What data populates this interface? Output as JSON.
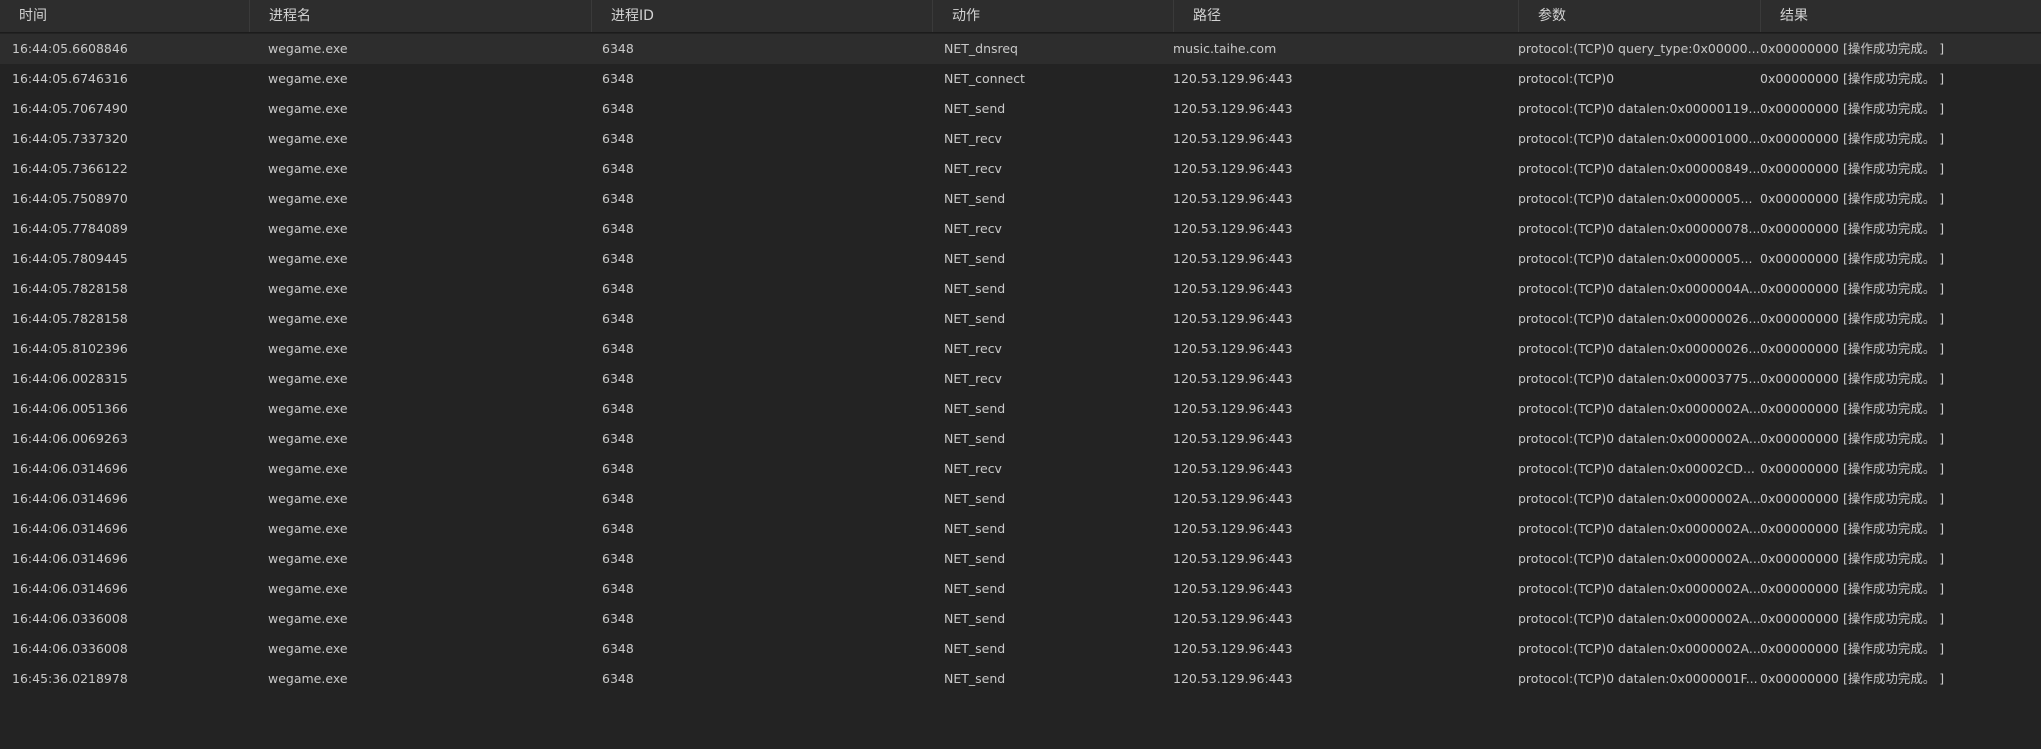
{
  "columns": [
    "时间",
    "进程名",
    "进程ID",
    "动作",
    "路径",
    "参数",
    "结果"
  ],
  "rows": [
    [
      "16:44:05.6608846",
      "wegame.exe",
      "6348",
      "NET_dnsreq",
      "music.taihe.com",
      "protocol:(TCP)0 query_type:0x00000...",
      "0x00000000 [操作成功完成。 ]"
    ],
    [
      "16:44:05.6746316",
      "wegame.exe",
      "6348",
      "NET_connect",
      "120.53.129.96:443",
      "protocol:(TCP)0",
      "0x00000000 [操作成功完成。 ]"
    ],
    [
      "16:44:05.7067490",
      "wegame.exe",
      "6348",
      "NET_send",
      "120.53.129.96:443",
      "protocol:(TCP)0 datalen:0x00000119...",
      "0x00000000 [操作成功完成。 ]"
    ],
    [
      "16:44:05.7337320",
      "wegame.exe",
      "6348",
      "NET_recv",
      "120.53.129.96:443",
      "protocol:(TCP)0 datalen:0x00001000...",
      "0x00000000 [操作成功完成。 ]"
    ],
    [
      "16:44:05.7366122",
      "wegame.exe",
      "6348",
      "NET_recv",
      "120.53.129.96:443",
      "protocol:(TCP)0 datalen:0x00000849...",
      "0x00000000 [操作成功完成。 ]"
    ],
    [
      "16:44:05.7508970",
      "wegame.exe",
      "6348",
      "NET_send",
      "120.53.129.96:443",
      "protocol:(TCP)0 datalen:0x0000005...",
      "0x00000000 [操作成功完成。 ]"
    ],
    [
      "16:44:05.7784089",
      "wegame.exe",
      "6348",
      "NET_recv",
      "120.53.129.96:443",
      "protocol:(TCP)0 datalen:0x00000078...",
      "0x00000000 [操作成功完成。 ]"
    ],
    [
      "16:44:05.7809445",
      "wegame.exe",
      "6348",
      "NET_send",
      "120.53.129.96:443",
      "protocol:(TCP)0 datalen:0x0000005...",
      "0x00000000 [操作成功完成。 ]"
    ],
    [
      "16:44:05.7828158",
      "wegame.exe",
      "6348",
      "NET_send",
      "120.53.129.96:443",
      "protocol:(TCP)0 datalen:0x0000004A...",
      "0x00000000 [操作成功完成。 ]"
    ],
    [
      "16:44:05.7828158",
      "wegame.exe",
      "6348",
      "NET_send",
      "120.53.129.96:443",
      "protocol:(TCP)0 datalen:0x00000026...",
      "0x00000000 [操作成功完成。 ]"
    ],
    [
      "16:44:05.8102396",
      "wegame.exe",
      "6348",
      "NET_recv",
      "120.53.129.96:443",
      "protocol:(TCP)0 datalen:0x00000026...",
      "0x00000000 [操作成功完成。 ]"
    ],
    [
      "16:44:06.0028315",
      "wegame.exe",
      "6348",
      "NET_recv",
      "120.53.129.96:443",
      "protocol:(TCP)0 datalen:0x00003775...",
      "0x00000000 [操作成功完成。 ]"
    ],
    [
      "16:44:06.0051366",
      "wegame.exe",
      "6348",
      "NET_send",
      "120.53.129.96:443",
      "protocol:(TCP)0 datalen:0x0000002A...",
      "0x00000000 [操作成功完成。 ]"
    ],
    [
      "16:44:06.0069263",
      "wegame.exe",
      "6348",
      "NET_send",
      "120.53.129.96:443",
      "protocol:(TCP)0 datalen:0x0000002A...",
      "0x00000000 [操作成功完成。 ]"
    ],
    [
      "16:44:06.0314696",
      "wegame.exe",
      "6348",
      "NET_recv",
      "120.53.129.96:443",
      "protocol:(TCP)0 datalen:0x00002CD...",
      "0x00000000 [操作成功完成。 ]"
    ],
    [
      "16:44:06.0314696",
      "wegame.exe",
      "6348",
      "NET_send",
      "120.53.129.96:443",
      "protocol:(TCP)0 datalen:0x0000002A...",
      "0x00000000 [操作成功完成。 ]"
    ],
    [
      "16:44:06.0314696",
      "wegame.exe",
      "6348",
      "NET_send",
      "120.53.129.96:443",
      "protocol:(TCP)0 datalen:0x0000002A...",
      "0x00000000 [操作成功完成。 ]"
    ],
    [
      "16:44:06.0314696",
      "wegame.exe",
      "6348",
      "NET_send",
      "120.53.129.96:443",
      "protocol:(TCP)0 datalen:0x0000002A...",
      "0x00000000 [操作成功完成。 ]"
    ],
    [
      "16:44:06.0314696",
      "wegame.exe",
      "6348",
      "NET_send",
      "120.53.129.96:443",
      "protocol:(TCP)0 datalen:0x0000002A...",
      "0x00000000 [操作成功完成。 ]"
    ],
    [
      "16:44:06.0336008",
      "wegame.exe",
      "6348",
      "NET_send",
      "120.53.129.96:443",
      "protocol:(TCP)0 datalen:0x0000002A...",
      "0x00000000 [操作成功完成。 ]"
    ],
    [
      "16:44:06.0336008",
      "wegame.exe",
      "6348",
      "NET_send",
      "120.53.129.96:443",
      "protocol:(TCP)0 datalen:0x0000002A...",
      "0x00000000 [操作成功完成。 ]"
    ],
    [
      "16:45:36.0218978",
      "wegame.exe",
      "6348",
      "NET_send",
      "120.53.129.96:443",
      "protocol:(TCP)0 datalen:0x0000001F...",
      "0x00000000 [操作成功完成。 ]"
    ]
  ]
}
